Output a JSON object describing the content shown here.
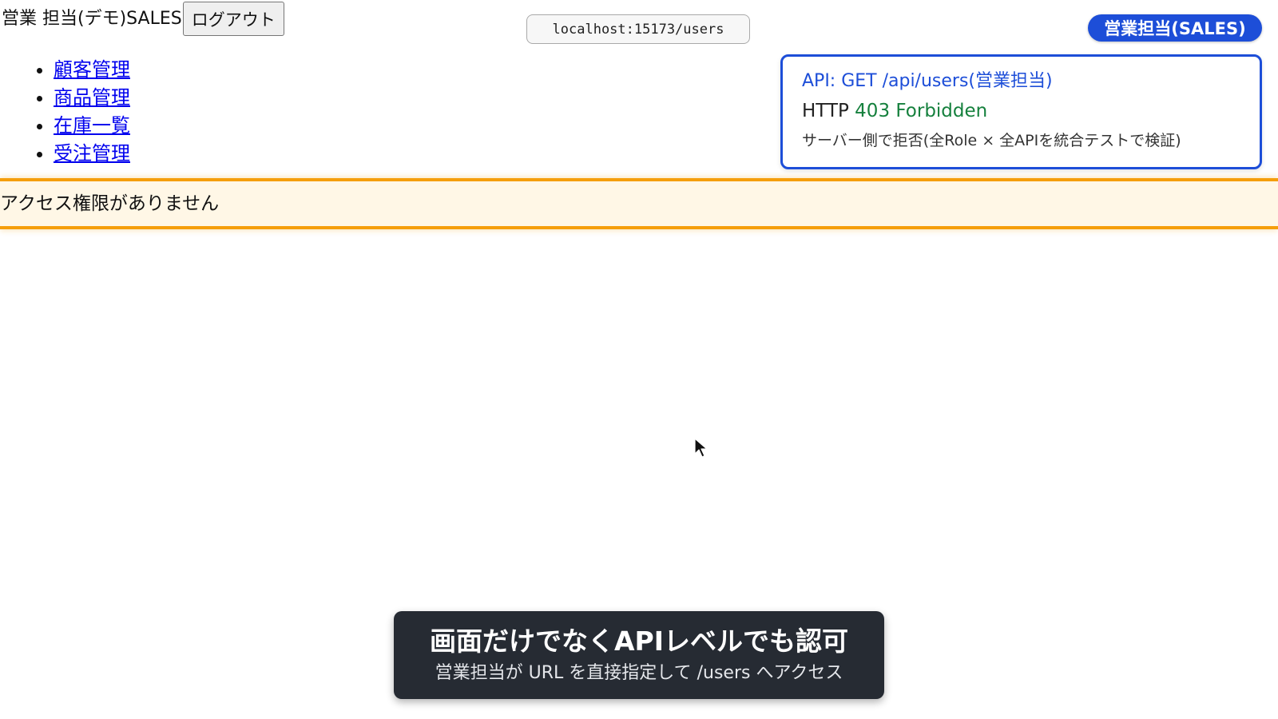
{
  "header": {
    "user_label": "営業 担当(デモ)SALES",
    "logout_label": "ログアウト"
  },
  "address_bar": {
    "url": "localhost:15173/users"
  },
  "role_badge": {
    "label": "営業担当(SALES)"
  },
  "nav": {
    "items": [
      {
        "label": "顧客管理"
      },
      {
        "label": "商品管理"
      },
      {
        "label": "在庫一覧"
      },
      {
        "label": "受注管理"
      }
    ]
  },
  "api_panel": {
    "request": "API: GET /api/users(営業担当)",
    "http_prefix": "HTTP ",
    "status": "403 Forbidden",
    "note": "サーバー側で拒否(全Role × 全APIを統合テストで検証)"
  },
  "alert": {
    "message": "アクセス権限がありません"
  },
  "caption": {
    "title": "画面だけでなくAPIレベルでも認可",
    "subtitle": "営業担当が URL を直接指定して /users へアクセス"
  },
  "colors": {
    "accent_blue": "#1d4ed8",
    "success_green": "#15803d",
    "warning_orange": "#f59e0b",
    "caption_bg": "#262b33"
  },
  "icons": {
    "cursor": "mouse-pointer-icon"
  }
}
